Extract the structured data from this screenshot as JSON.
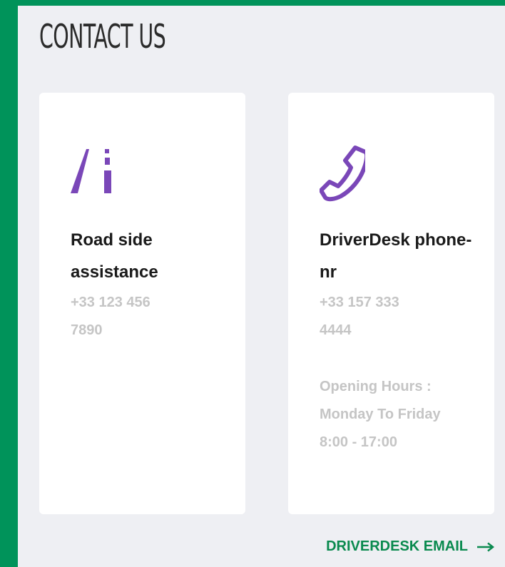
{
  "page": {
    "title": "CONTACT US"
  },
  "cards": [
    {
      "title": "Road side assistance",
      "phone": "+33 123 456 7890",
      "icon": "road-icon"
    },
    {
      "title": "DriverDesk phone-nr",
      "phone": "+33 157 333 4444",
      "hours": "Opening Hours : Monday To Friday 8:00 - 17:00",
      "icon": "phone-icon"
    }
  ],
  "email_link": {
    "label": "DRIVERDESK EMAIL",
    "icon": "arrow-right-icon"
  },
  "colors": {
    "sidebar": "#00935a",
    "background": "#eeeff3",
    "card": "#ffffff",
    "icon_accent": "#7a47b8",
    "link": "#0a8a4f",
    "muted_text": "#c5c5c5"
  }
}
